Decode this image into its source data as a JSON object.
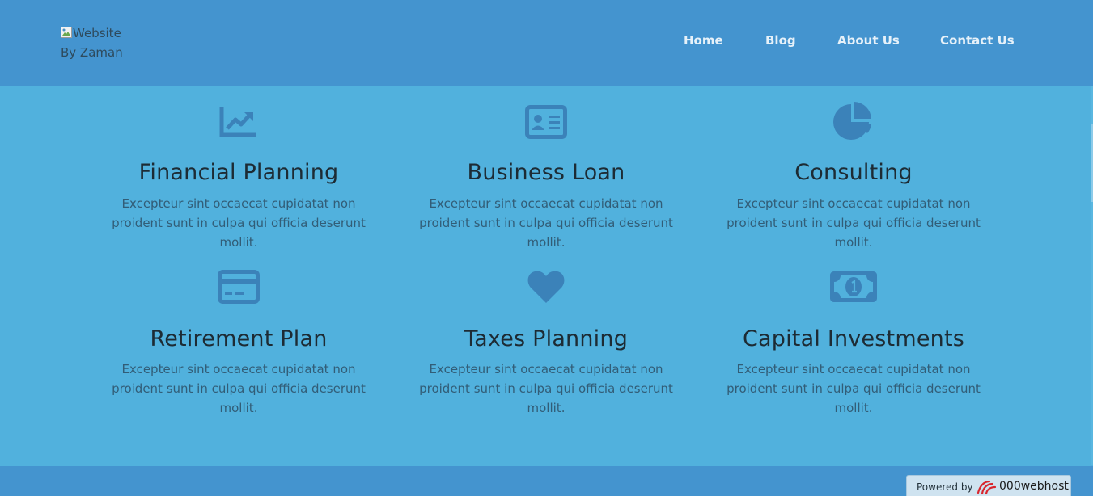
{
  "header": {
    "logo_alt": "Website By Zaman",
    "nav": [
      {
        "label": "Home"
      },
      {
        "label": "Blog"
      },
      {
        "label": "About Us"
      },
      {
        "label": "Contact Us"
      }
    ]
  },
  "services": [
    {
      "title": "Financial Planning",
      "text": "Excepteur sint occaecat cupidatat non proident sunt in culpa qui officia deserunt mollit.",
      "icon": "chart-line-icon"
    },
    {
      "title": "Business Loan",
      "text": "Excepteur sint occaecat cupidatat non proident sunt in culpa qui officia deserunt mollit.",
      "icon": "id-card-icon"
    },
    {
      "title": "Consulting",
      "text": "Excepteur sint occaecat cupidatat non proident sunt in culpa qui officia deserunt mollit.",
      "icon": "pie-chart-icon"
    },
    {
      "title": "Retirement Plan",
      "text": "Excepteur sint occaecat cupidatat non proident sunt in culpa qui officia deserunt mollit.",
      "icon": "credit-card-icon"
    },
    {
      "title": "Taxes Planning",
      "text": "Excepteur sint occaecat cupidatat non proident sunt in culpa qui officia deserunt mollit.",
      "icon": "heart-icon"
    },
    {
      "title": "Capital Investments",
      "text": "Excepteur sint occaecat cupidatat non proident sunt in culpa qui officia deserunt mollit.",
      "icon": "money-bill-icon"
    }
  ],
  "badge": {
    "powered_by": "Powered by",
    "host_name": "000webhost"
  },
  "colors": {
    "header_bg": "#4494cf",
    "section_bg": "#51b1dd",
    "icon": "#3b82b9"
  }
}
